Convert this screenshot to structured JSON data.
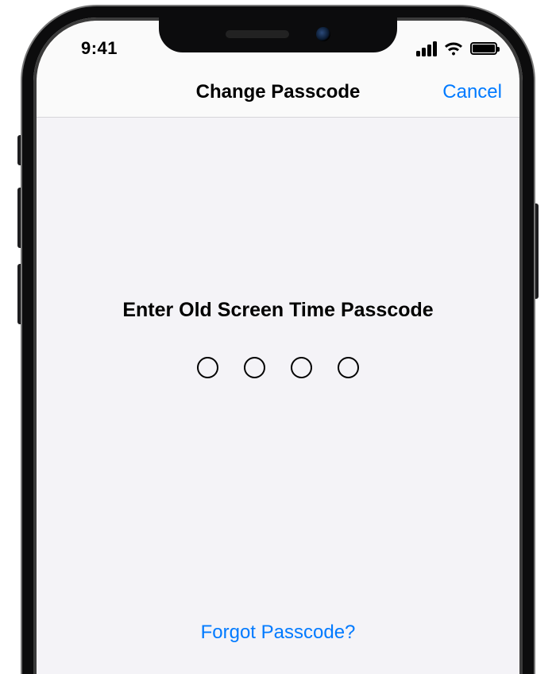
{
  "status": {
    "time": "9:41"
  },
  "nav": {
    "title": "Change Passcode",
    "cancel": "Cancel"
  },
  "content": {
    "prompt": "Enter Old Screen Time Passcode",
    "passcode_length": 4,
    "forgot": "Forgot Passcode?"
  },
  "colors": {
    "tint": "#007aff",
    "background": "#f4f3f7"
  }
}
